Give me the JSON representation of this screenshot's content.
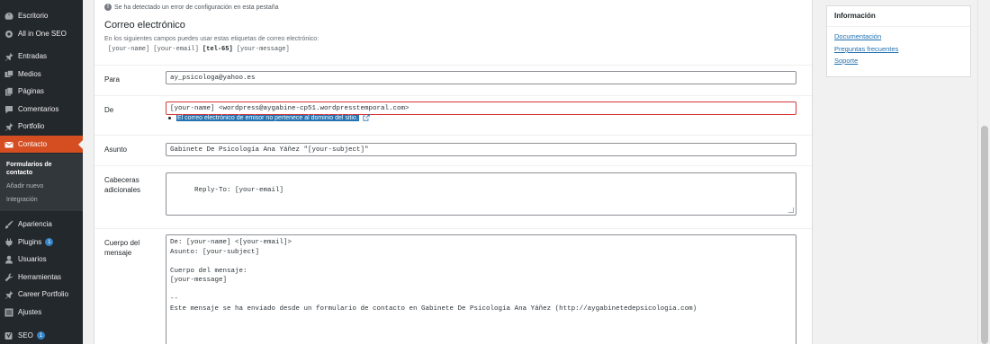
{
  "sidebar": {
    "items": [
      {
        "label": "Escritorio",
        "icon": "dashboard-icon"
      },
      {
        "label": "All in One SEO",
        "icon": "aioseo-icon"
      },
      {
        "label": "Entradas",
        "icon": "pin-icon"
      },
      {
        "label": "Medios",
        "icon": "media-icon"
      },
      {
        "label": "Páginas",
        "icon": "pages-icon"
      },
      {
        "label": "Comentarios",
        "icon": "comments-icon"
      },
      {
        "label": "Portfolio",
        "icon": "pin-icon"
      },
      {
        "label": "Contacto",
        "icon": "mail-icon"
      },
      {
        "label": "Apariencia",
        "icon": "brush-icon"
      },
      {
        "label": "Plugins",
        "icon": "plugins-icon",
        "badge": "1"
      },
      {
        "label": "Usuarios",
        "icon": "users-icon"
      },
      {
        "label": "Herramientas",
        "icon": "tools-icon"
      },
      {
        "label": "Career Portfolio",
        "icon": "pin-icon"
      },
      {
        "label": "Ajustes",
        "icon": "settings-icon"
      },
      {
        "label": "SEO",
        "icon": "yoast-icon",
        "badge": "1"
      }
    ],
    "submenu": [
      {
        "label": "Formularios de contacto"
      },
      {
        "label": "Añadir nuevo"
      },
      {
        "label": "Integración"
      }
    ]
  },
  "notice": "Se ha detectado un error de configuración en esta pestaña",
  "mail": {
    "section_title": "Correo electrónico",
    "tags_intro": "En los siguientes campos puedes usar estas etiquetas de correo electrónico:",
    "tags": [
      "[your-name]",
      "[your-email]",
      "[tel-65]",
      "[your-message]"
    ],
    "fields": {
      "to": {
        "label": "Para",
        "value": "ay_psicologa@yahoo.es"
      },
      "from": {
        "label": "De",
        "value": "[your-name] <wordpress@aygabine-cp51.wordpresstemporal.com>",
        "error": "El correo electrónico de emisor no pertenece al dominio del sitio."
      },
      "subject": {
        "label": "Asunto",
        "value": "Gabinete De Psicología Ana Yáñez \"[your-subject]\""
      },
      "headers": {
        "label": "Cabeceras adicionales",
        "value": "Reply-To: [your-email]"
      },
      "body": {
        "label": "Cuerpo del mensaje",
        "value": "De: [your-name] <[your-email]>\nAsunto: [your-subject]\n\nCuerpo del mensaje:\n[your-message]\n\n--\nEste mensaje se ha enviado desde un formulario de contacto en Gabinete De Psicología Ana Yáñez (http://aygabinetedepsicologia.com)"
      }
    }
  },
  "info": {
    "title": "Información",
    "links": [
      "Documentación",
      "Preguntas frecuentes",
      "Soporte"
    ]
  },
  "colors": {
    "sidebar_bg": "#23282d",
    "active_menu": "#d54e21",
    "error_border": "#d63638",
    "highlight": "#2271b1"
  }
}
